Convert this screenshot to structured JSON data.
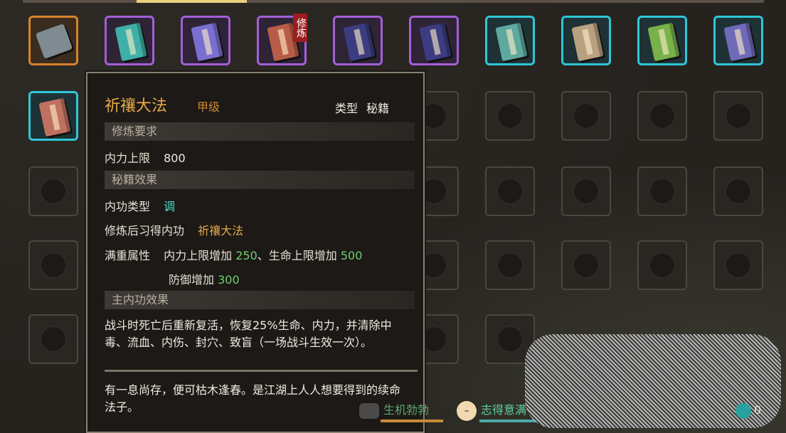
{
  "inventory": {
    "slots": [
      {
        "rarity": "orange",
        "icon": "tool-icon",
        "color": "#7f8b90"
      },
      {
        "rarity": "purple",
        "icon": "book-icon",
        "color": "#3fb0a8"
      },
      {
        "rarity": "purple",
        "icon": "book-icon",
        "color": "#7a6fd0"
      },
      {
        "rarity": "purple",
        "icon": "book-icon",
        "color": "#b85c4a",
        "badge": "修炼"
      },
      {
        "rarity": "purple",
        "icon": "book-icon",
        "color": "#3c3c80"
      },
      {
        "rarity": "purple",
        "icon": "book-icon",
        "color": "#3c3c80"
      },
      {
        "rarity": "cyan",
        "icon": "book-icon",
        "color": "#5fa8a0"
      },
      {
        "rarity": "cyan",
        "icon": "book-icon",
        "color": "#b8a080"
      },
      {
        "rarity": "cyan",
        "icon": "book-icon",
        "color": "#78b04a"
      },
      {
        "rarity": "cyan",
        "icon": "book-icon",
        "color": "#6f6ab8"
      },
      {
        "rarity": "cyan",
        "icon": "book-icon",
        "color": "#c07060"
      }
    ]
  },
  "tooltip": {
    "name": "祈禳大法",
    "grade": "甲级",
    "type_label": "类型",
    "type_value": "秘籍",
    "section_requirements": "修炼要求",
    "req_label": "内力上限",
    "req_value": "800",
    "section_effects": "秘籍效果",
    "kungfu_type_label": "内功类型",
    "kungfu_type_value": "调",
    "learn_label": "修炼后习得内功",
    "learn_value": "祈禳大法",
    "full_attr_label": "满重属性",
    "attr1_label": "内力上限增加",
    "attr1_value": "250",
    "attr_sep": "、生命上限增加",
    "attr2_value": "500",
    "attr3_label": "防御增加",
    "attr3_value": "300",
    "section_main": "主内功效果",
    "main_effect": "战斗时死亡后重新复活，恢复25%生命、内力，并清除中毒、流血、内伤、封穴、致盲（一场战斗生效一次）。",
    "flavor": "有一息尚存，便可枯木逢春。是江湖上人人想要得到的续命法子。"
  },
  "status_bar": {
    "vitality": "生机勃勃",
    "mood": "志得意满",
    "mood_icon": "smiley-face-icon",
    "money": "0"
  }
}
